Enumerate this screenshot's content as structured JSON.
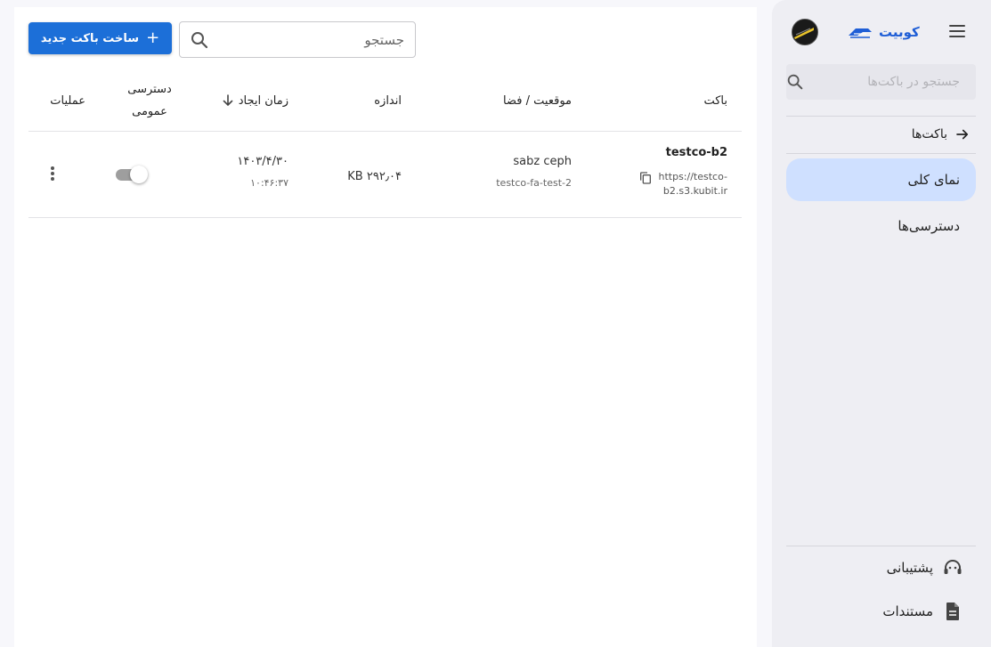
{
  "sidebar": {
    "brand": "کوبیت",
    "search_placeholder": "جستجو در باکت‌ها",
    "back_label": "باکت‌ها",
    "nav": [
      {
        "label": "نمای کلی",
        "active": true
      },
      {
        "label": "دسترسی‌ها",
        "active": false
      }
    ],
    "footer": [
      {
        "label": "پشتیبانی",
        "icon": "headset-icon"
      },
      {
        "label": "مستندات",
        "icon": "document-icon"
      }
    ]
  },
  "toolbar": {
    "create_label": "ساخت باکت جدید",
    "search_placeholder": "جستجو"
  },
  "table": {
    "headers": {
      "bucket": "باکت",
      "location": "موقعیت / فضا",
      "size": "اندازه",
      "created": "زمان ایجاد",
      "public_access_line1": "دسترسی",
      "public_access_line2": "عمومی",
      "actions": "عملیات"
    },
    "sort": {
      "column": "created",
      "direction": "desc"
    },
    "rows": [
      {
        "name": "testco-b2",
        "url_line1": "https://testco-",
        "url_line2": "b2.s3.kubit.ir",
        "location": "sabz ceph",
        "space": "testco-fa-test-2",
        "size": "۲۹۲٫۰۴ KB",
        "created_date": "۱۴۰۳/۴/۳۰",
        "created_time": "۱۰:۴۶:۳۷",
        "public": false
      }
    ]
  },
  "colors": {
    "accent": "#1c6fd8",
    "brand": "#1f5ed6",
    "active_nav": "#cfe0ff"
  }
}
